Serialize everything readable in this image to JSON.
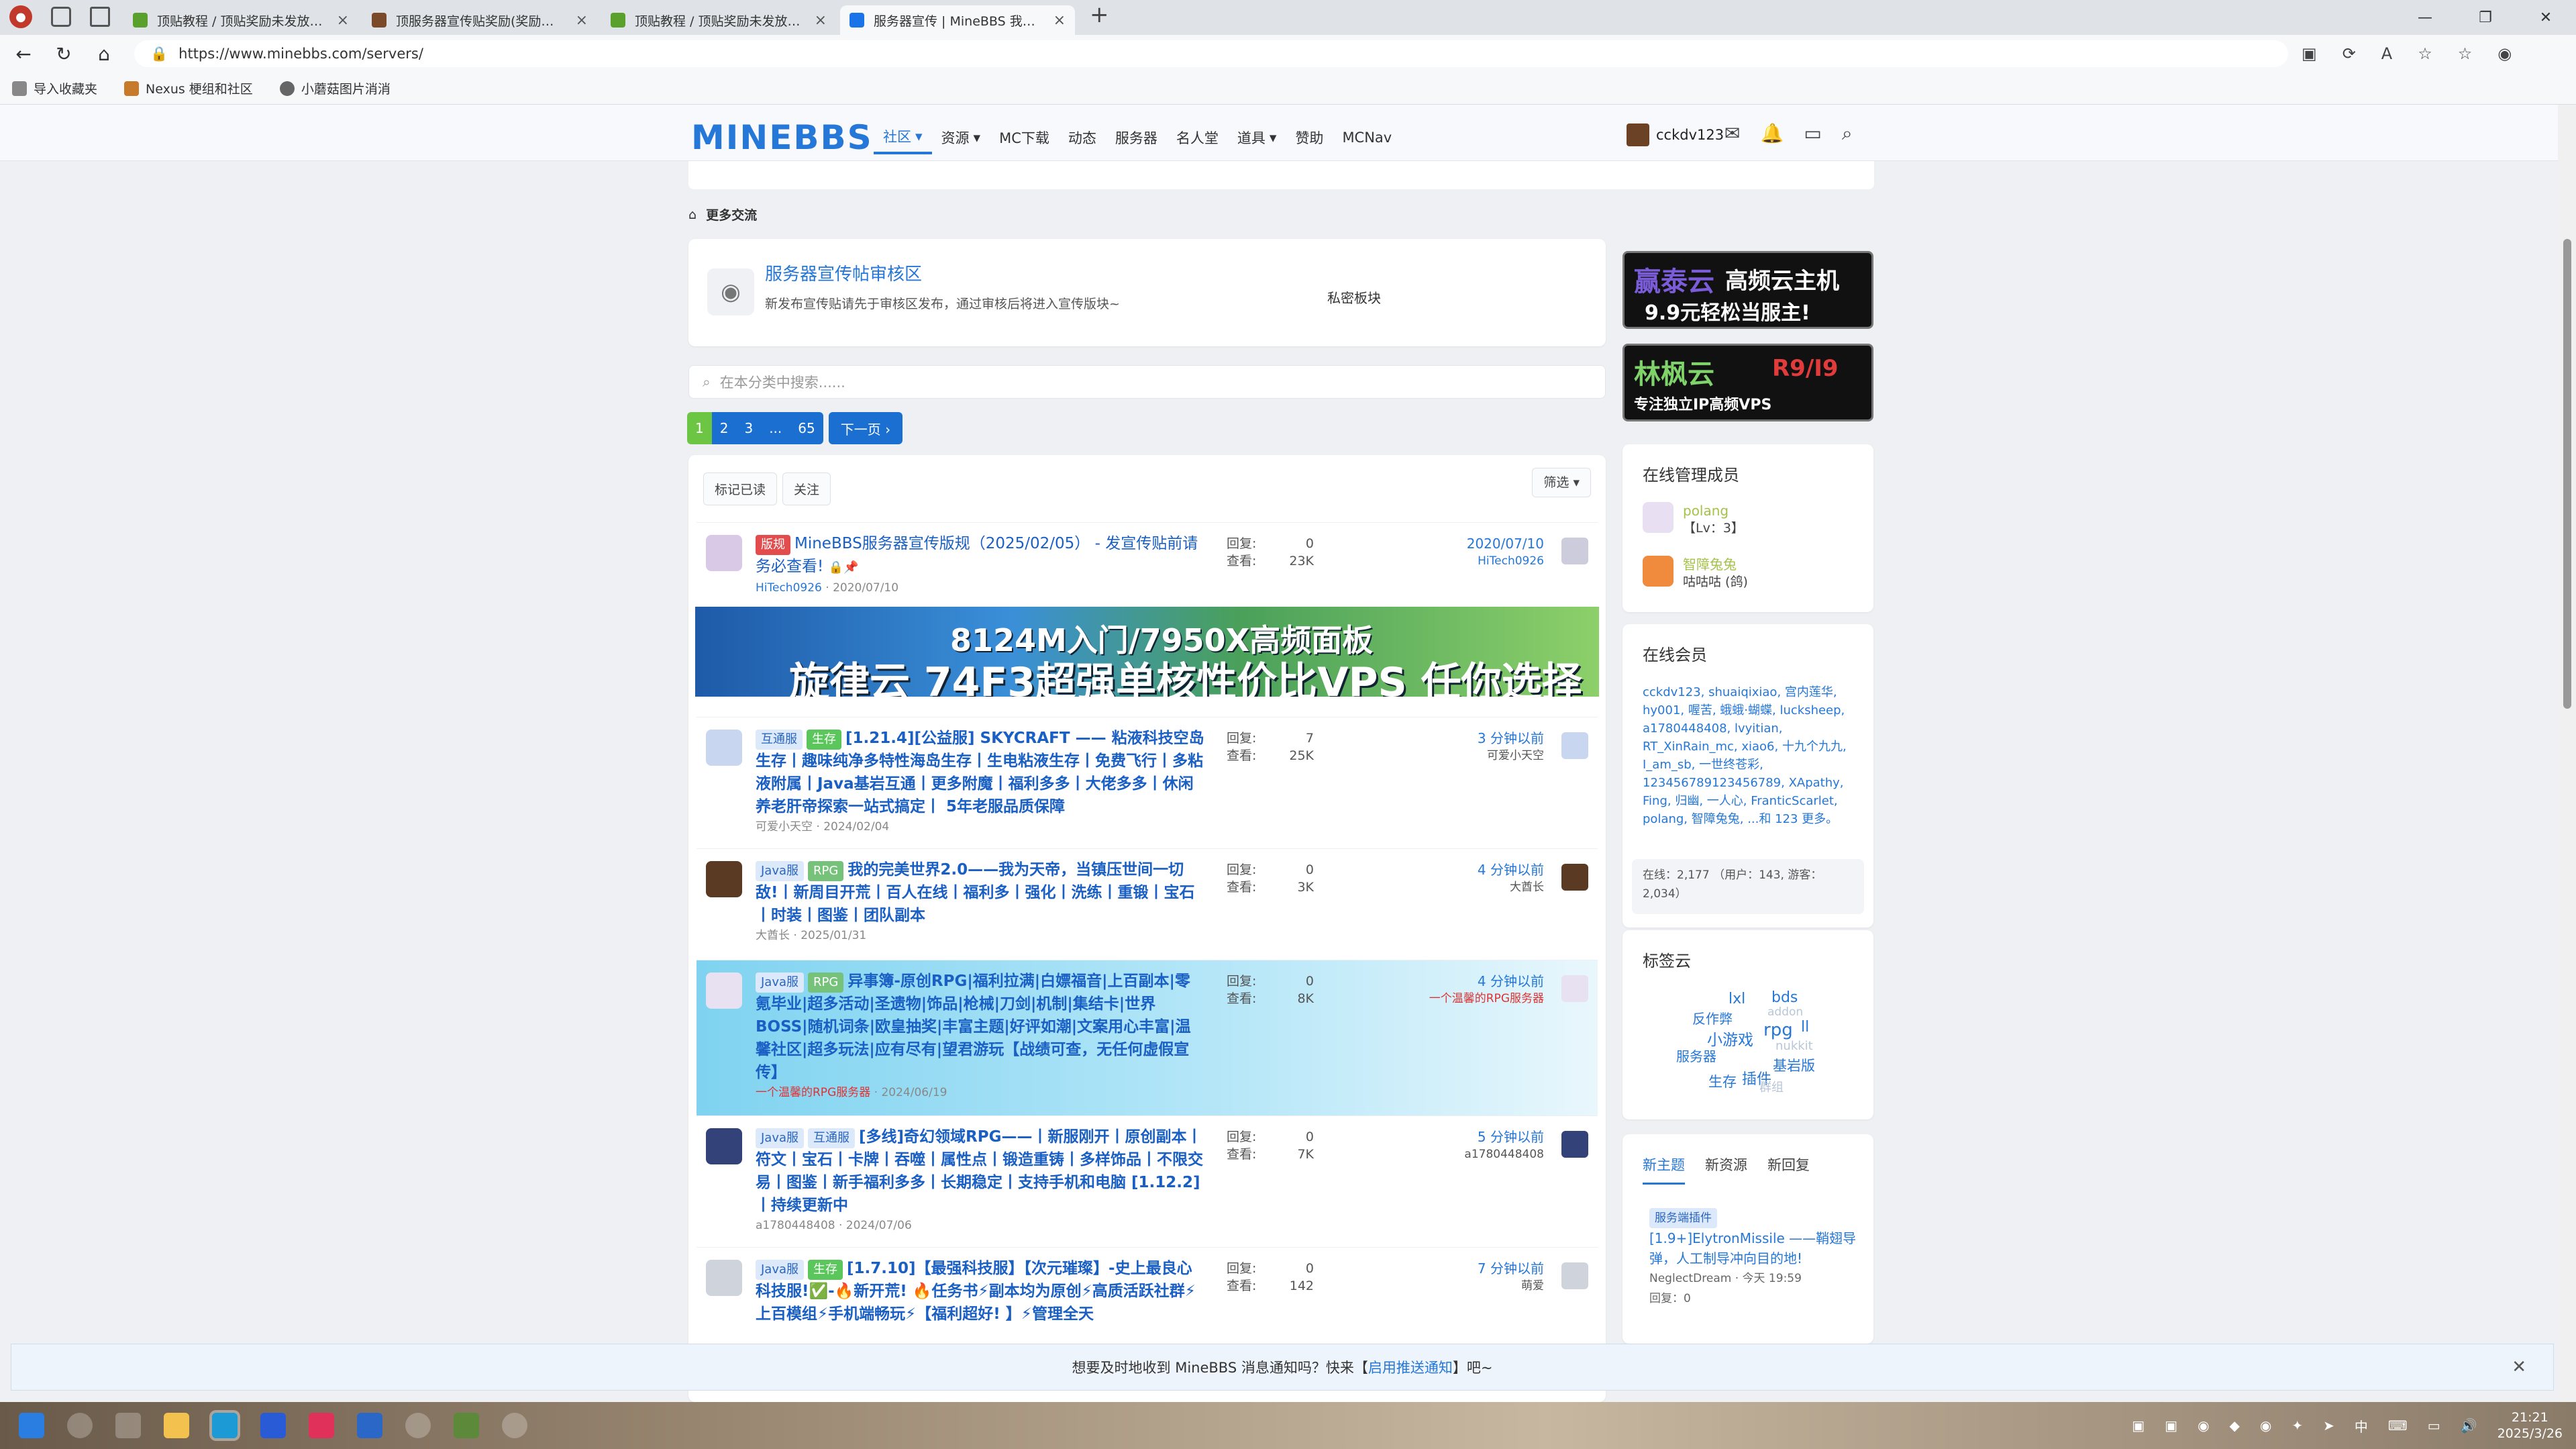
{
  "browser": {
    "tabs": [
      {
        "title": "顶贴教程 / 顶贴奖励未发放补领帖",
        "active": false
      },
      {
        "title": "顶服务器宣传贴奖励(奖励天空点",
        "active": false
      },
      {
        "title": "顶贴教程 / 顶贴奖励未发放补领帖",
        "active": false
      },
      {
        "title": "服务器宣传 | MineBBS 我的世界中",
        "active": true
      }
    ],
    "url": "https://www.minebbs.com/servers/",
    "favorites": [
      "导入收藏夹",
      "Nexus 梗组和社区",
      "小蘑菇图片消消"
    ]
  },
  "site": {
    "logo": "MINEBBS",
    "nav": [
      "社区",
      "资源",
      "MC下载",
      "动态",
      "服务器",
      "名人堂",
      "道具",
      "赞助",
      "MCNav"
    ],
    "username": "cckdv123"
  },
  "breadcrumb": "更多交流",
  "subforum": {
    "title": "服务器宣传帖审核区",
    "desc": "新发布宣传贴请先于审核区发布，通过审核后将进入宣传版块~",
    "status": "私密板块"
  },
  "search_placeholder": "在本分类中搜索......",
  "pager": {
    "pages": [
      "1",
      "2",
      "3",
      "...",
      "65"
    ],
    "next": "下一页 ›"
  },
  "toolbar": {
    "mark_read": "标记已读",
    "watch": "关注",
    "filter": "筛选 ▾"
  },
  "threads": [
    {
      "prefixes": [
        "版规"
      ],
      "title": "MineBBS服务器宣传版规（2025/02/05） - 发宣传贴前请务必查看!",
      "author": "HiTech0926",
      "date": "2020/07/10",
      "replies": "0",
      "views": "23K",
      "last_time": "2020/07/10",
      "last_user": "HiTech0926"
    },
    {
      "prefixes": [
        "互通服",
        "生存"
      ],
      "title": "[1.21.4][公益服] SKYCRAFT —— 粘液科技空岛生存丨趣味纯净多特性海岛生存丨生电粘液生存丨免费飞行丨多粘液附属丨Java基岩互通丨更多附魔丨福利多多丨大佬多多丨休闲养老肝帝探索一站式搞定丨 5年老服品质保障",
      "author": "可爱小天空",
      "date": "2024/02/04",
      "replies": "7",
      "views": "25K",
      "last_time": "3 分钟以前",
      "last_user": "可爱小天空"
    },
    {
      "prefixes": [
        "Java服",
        "RPG"
      ],
      "title": "我的完美世界2.0——我为天帝，当镇压世间一切敌!丨新周目开荒丨百人在线丨福利多丨强化丨洗练丨重锻丨宝石丨时装丨图鉴丨团队副本",
      "author": "大酋长",
      "date": "2025/01/31",
      "replies": "0",
      "views": "3K",
      "last_time": "4 分钟以前",
      "last_user": "大酋长"
    },
    {
      "prefixes": [
        "Java服",
        "RPG"
      ],
      "title": "异事簿-原创RPG|福利拉满|白嫖福音|上百副本|零氪毕业|超多活动|圣遗物|饰品|枪械|刀剑|机制|集结卡|世界BOSS|随机词条|欧皇抽奖|丰富主题|好评如潮|文案用心丰富|温馨社区|超多玩法|应有尽有|望君游玩【战绩可查，无任何虚假宣传】",
      "author": "一个温馨的RPG服务器",
      "date": "2024/06/19",
      "replies": "0",
      "views": "8K",
      "last_time": "4 分钟以前",
      "last_user": "一个温馨的RPG服务器"
    },
    {
      "prefixes": [
        "Java服",
        "互通服"
      ],
      "title": "[多线]奇幻领域RPG——丨新服刚开丨原创副本丨符文丨宝石丨卡牌丨吞噬丨属性点丨锻造重铸丨多样饰品丨不限交易丨图鉴丨新手福利多多丨长期稳定丨支持手机和电脑 [1.12.2]丨持续更新中",
      "author": "a1780448408",
      "date": "2024/07/06",
      "replies": "0",
      "views": "7K",
      "last_time": "5 分钟以前",
      "last_user": "a1780448408"
    },
    {
      "prefixes": [
        "Java服",
        "生存"
      ],
      "title": "[1.7.10]【最强科技服】【次元璀璨】-史上最良心科技服!✅-🔥新开荒! 🔥任务书⚡副本均为原创⚡高质活跃社群⚡上百模组⚡手机端畅玩⚡【福利超好! 】⚡管理全天",
      "author": "萌爱",
      "date": "",
      "replies": "0",
      "views": "142",
      "last_time": "7 分钟以前",
      "last_user": "萌爱"
    }
  ],
  "stat_labels": {
    "replies": "回复:",
    "views": "查看:"
  },
  "banner": {
    "line1": "8124M入门/7950X高频面板",
    "line2": "旋律云 74F3超强单核性价比VPS 任你选择"
  },
  "ads": [
    {
      "a": "赢泰云",
      "b": "高频云主机",
      "c": "9.9元轻松当服主!"
    },
    {
      "a": "林枫云",
      "b": "R9/I9",
      "c": "专注独立IP高频VPS"
    }
  ],
  "staff": {
    "title": "在线管理成员",
    "items": [
      {
        "name": "polang",
        "title": "【Lv：3】"
      },
      {
        "name": "智障兔兔",
        "title": "咕咕咕 (鸽)"
      }
    ]
  },
  "online": {
    "title": "在线会员",
    "members": "cckdv123, shuaiqixiao, 宫内莲华, hy001, 喔苦, 蛾蛾·蝴蝶, lucksheep, a1780448408, lvyitian, RT_XinRain_mc, xiao6, 十九个九九, I_am_sb, 一世终苍彩, 123456789123456789, XApathy, Fing, 归幽, 一人心, FranticScarlet, polang, 智障兔兔, ...和 123 更多。",
    "count": "在线：2,177 （用户：143, 游客：2,034）"
  },
  "tagcloud": {
    "title": "标签云",
    "tags": [
      "lxl",
      "bds",
      "反作弊",
      "addon",
      "小游戏",
      "rpg",
      "ll",
      "服务器",
      "nukkit",
      "基岩版",
      "生存",
      "插件",
      "群组"
    ]
  },
  "sidetabs": {
    "tabs": [
      "新主题",
      "新资源",
      "新回复"
    ],
    "item": {
      "tag": "服务端插件",
      "title": "[1.9+]ElytronMissile ——鞘翅导弹，人工制导冲向目的地!",
      "author": "NeglectDream",
      "time": "今天 19:59",
      "replies": "回复：0"
    }
  },
  "notify": {
    "text": "想要及时地收到 MineBBS 消息通知吗？快来【",
    "link": "启用推送通知",
    "tail": "】吧~"
  },
  "taskbar": {
    "time": "21:21",
    "date": "2025/3/26",
    "ime": "中"
  }
}
